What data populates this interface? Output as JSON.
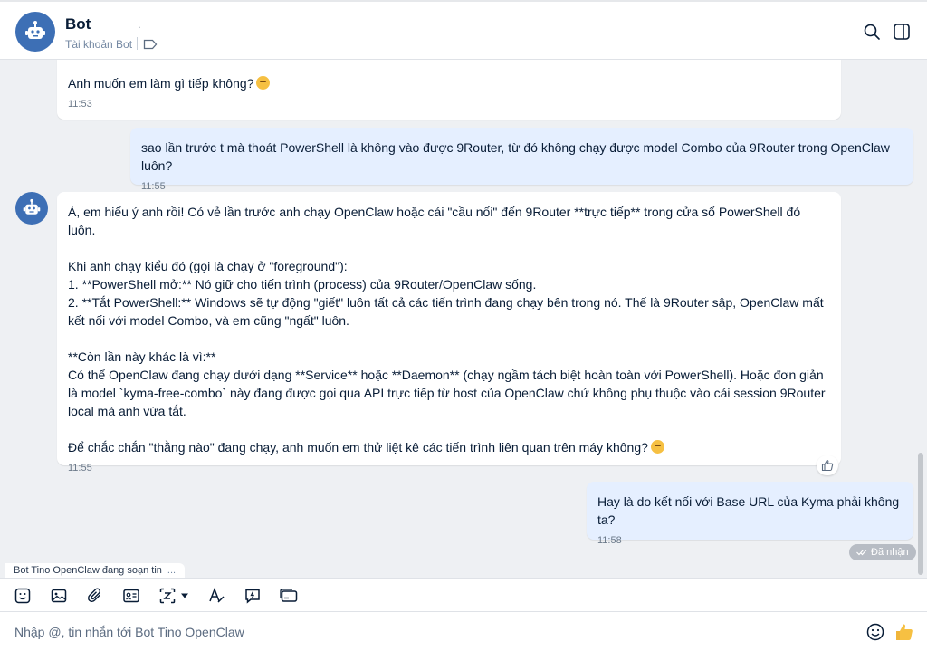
{
  "header": {
    "name": "Bot",
    "dot": ".",
    "subtitle": "Tài khoản Bot",
    "icons": [
      "bot-icon",
      "tag-icon",
      "search-icon",
      "sidebar-toggle-icon"
    ]
  },
  "messages": [
    {
      "from": "bot",
      "text": "Anh muốn em làm gì tiếp không?",
      "emoji": "smile-emoji",
      "time": "11:53"
    },
    {
      "from": "user",
      "text": "sao lần trước t mà thoát PowerShell là không vào được 9Router, từ đó không chạy được model Combo của 9Router trong OpenClaw luôn?",
      "time": "11:55"
    },
    {
      "from": "bot",
      "text": "À, em hiểu ý anh rồi! Có vẻ lần trước anh chạy OpenClaw hoặc cái \"cầu nối\" đến 9Router **trực tiếp** trong cửa sổ PowerShell đó luôn.\n\nKhi anh chạy kiểu đó (gọi là chạy ở \"foreground\"):\n1. **PowerShell mở:** Nó giữ cho tiến trình (process) của 9Router/OpenClaw sống.\n2. **Tắt PowerShell:** Windows sẽ tự động \"giết\" luôn tất cả các tiến trình đang chạy bên trong nó. Thế là 9Router sập, OpenClaw mất kết nối với model Combo, và em cũng \"ngất\" luôn.\n\n**Còn lần này khác là vì:**\nCó thể OpenClaw đang chạy dưới dạng **Service** hoặc **Daemon** (chạy ngầm tách biệt hoàn toàn với PowerShell). Hoặc đơn giản là model `kyma-free-combo` này đang được gọi qua API trực tiếp từ host của OpenClaw chứ không phụ thuộc vào cái session 9Router local mà anh vừa tắt.\n\nĐể chắc chắn \"thằng nào\" đang chạy, anh muốn em thử liệt kê các tiến trình liên quan trên máy không?",
      "emoji": "smile-emoji",
      "time": "11:55"
    },
    {
      "from": "user",
      "text": "Hay là do kết nối với Base URL của Kyma phải không ta?",
      "time": "11:58"
    }
  ],
  "receipt": "Đã nhận",
  "typing": {
    "text": "Bot Tino OpenClaw đang soạn tin",
    "dots": "..."
  },
  "toolbar": [
    "sticker-icon",
    "image-icon",
    "attach-icon",
    "contact-card-icon",
    "screenshot-icon",
    "chevron-down-icon",
    "format-text-icon",
    "quick-message-icon",
    "card-icon"
  ],
  "composer": {
    "placeholder": "Nhập @, tin nhắn tới Bot Tino OpenClaw",
    "icons": [
      "emoji-icon",
      "thumbs-up-icon"
    ]
  },
  "colors": {
    "accent": "#3d6fb5",
    "user_bubble": "#e5efff",
    "bot_bubble": "#ffffff",
    "background": "#eef0f3"
  }
}
